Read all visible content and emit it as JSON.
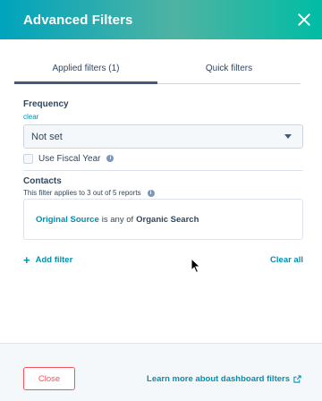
{
  "header": {
    "title": "Advanced Filters"
  },
  "tabs": [
    {
      "label": "Applied filters (1)",
      "active": true
    },
    {
      "label": "Quick filters",
      "active": false
    }
  ],
  "frequency": {
    "label": "Frequency",
    "clear_label": "clear",
    "selected": "Not set",
    "fiscal_year_label": "Use Fiscal Year",
    "fiscal_year_checked": false
  },
  "contacts": {
    "label": "Contacts",
    "applies_text": "This filter applies to 3 out of 5 reports",
    "filter": {
      "property": "Original Source",
      "operator": "is any of",
      "value": "Organic Search"
    }
  },
  "actions": {
    "add_filter": "Add filter",
    "clear_all": "Clear all"
  },
  "footer": {
    "close_label": "Close",
    "learn_more": "Learn more about dashboard filters"
  },
  "colors": {
    "header_start": "#00a4bd",
    "header_end": "#00bda5",
    "link": "#0091ae",
    "close_button": "#f2545b"
  },
  "icons": [
    "close-icon",
    "caret-down-icon",
    "info-icon",
    "plus-icon",
    "external-link-icon",
    "mouse-cursor-icon"
  ]
}
